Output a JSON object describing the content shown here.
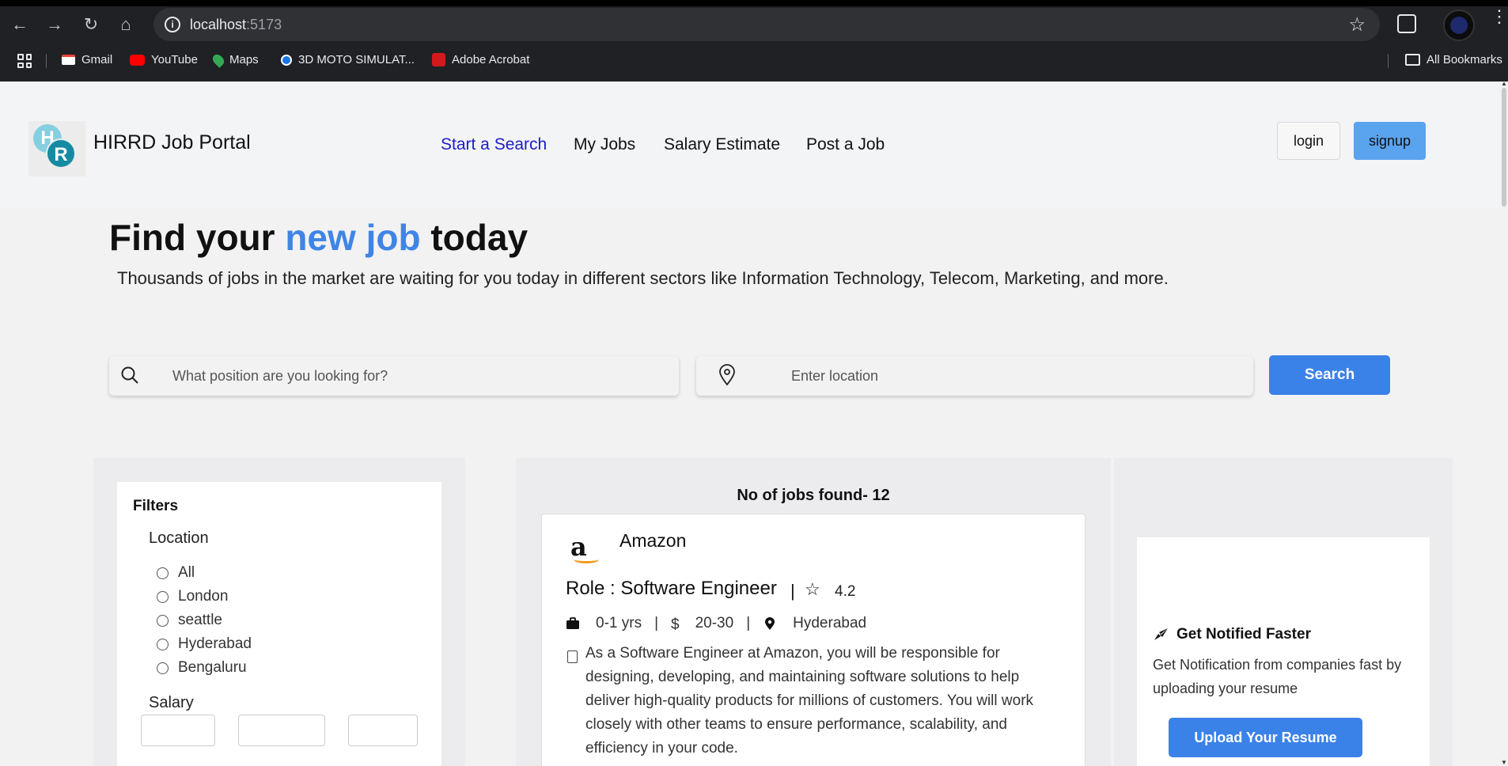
{
  "browser": {
    "url_host": "localhost",
    "url_port": ":5173",
    "bookmarks": [
      {
        "label": "Gmail",
        "icon": "gmail-icon",
        "color": "#ea4335"
      },
      {
        "label": "YouTube",
        "icon": "youtube-icon",
        "color": "#ff0000"
      },
      {
        "label": "Maps",
        "icon": "maps-icon",
        "color": "#34a853"
      },
      {
        "label": "3D MOTO SIMULAT...",
        "icon": "globe-icon",
        "color": "#1a73e8"
      },
      {
        "label": "Adobe Acrobat",
        "icon": "acrobat-icon",
        "color": "#d4191c"
      }
    ],
    "all_bookmarks": "All Bookmarks"
  },
  "header": {
    "logo_h": "H",
    "logo_r": "R",
    "brand": "HIRRD Job Portal",
    "nav": [
      "Start a Search",
      "My Jobs",
      "Salary Estimate",
      "Post a Job"
    ],
    "login": "login",
    "signup": "signup"
  },
  "hero": {
    "title_pre": "Find your ",
    "title_highlight": "new job",
    "title_post": " today",
    "subtitle": "Thousands of jobs in the market are waiting for you today in different sectors like Information Technology, Telecom, Marketing, and more."
  },
  "search": {
    "position_placeholder": "What position are you looking for?",
    "location_placeholder": "Enter location",
    "button": "Search"
  },
  "filters": {
    "title": "Filters",
    "location_title": "Location",
    "locations": [
      "All",
      "London",
      "seattle",
      "Hyderabad",
      "Bengaluru"
    ],
    "salary_title": "Salary"
  },
  "results": {
    "count_text": "No of jobs found- 12",
    "job": {
      "company_logo": "a",
      "company": "Amazon",
      "role": "Role : Software Engineer",
      "separator": "|",
      "rating": "4.2",
      "experience": "0-1 yrs",
      "salary": "20-30",
      "location": "Hyderabad",
      "description": "As a Software Engineer at Amazon, you will be responsible for designing, developing, and maintaining software solutions to help deliver high-quality products for millions of customers. You will work closely with other teams to ensure performance, scalability, and efficiency in your code."
    }
  },
  "notify": {
    "title": "Get Notified Faster",
    "text": "Get Notification from companies fast by uploading your resume",
    "button": "Upload Your Resume"
  },
  "colors": {
    "accent": "#3b82e8",
    "highlight": "#3f85e6",
    "nav_active": "#1c1cc8",
    "signup": "#5aa3ee"
  }
}
